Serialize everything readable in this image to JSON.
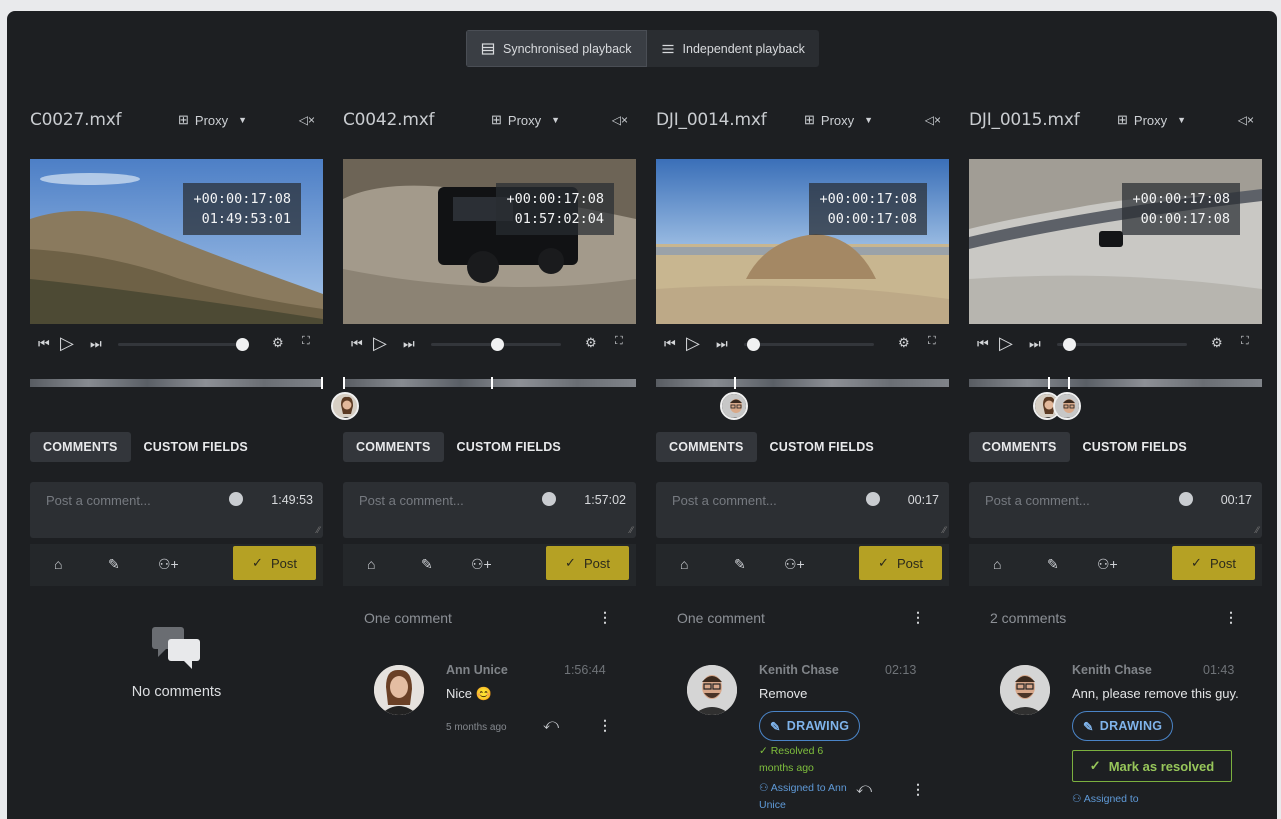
{
  "toolbar": {
    "sync_label": "Synchronised playback",
    "indep_label": "Independent playback"
  },
  "common": {
    "proxy_label": "Proxy",
    "tab_comments": "COMMENTS",
    "tab_custom_fields": "CUSTOM FIELDS",
    "comment_placeholder": "Post a comment...",
    "post_label": "Post"
  },
  "columns": [
    {
      "filename": "C0027.mxf",
      "tc_offset": "+00:00:17:08",
      "tc_abs": "01:49:53:01",
      "compose_time": "1:49:53",
      "progress": 0.93
    },
    {
      "filename": "C0042.mxf",
      "tc_offset": "+00:00:17:08",
      "tc_abs": "01:57:02:04",
      "compose_time": "1:57:02",
      "progress": 0.55
    },
    {
      "filename": "DJI_0014.mxf",
      "tc_offset": "+00:00:17:08",
      "tc_abs": "00:00:17:08",
      "compose_time": "00:17",
      "progress": 0.03
    },
    {
      "filename": "DJI_0015.mxf",
      "tc_offset": "+00:00:17:08",
      "tc_abs": "00:00:17:08",
      "compose_time": "00:17",
      "progress": 0.03
    }
  ],
  "col1": {
    "no_comments": "No comments"
  },
  "col2": {
    "count": "One comment",
    "author": "Ann Unice",
    "time": "1:56:44",
    "text": "Nice 😊",
    "ago": "5 months ago"
  },
  "col3": {
    "count": "One comment",
    "author": "Kenith Chase",
    "time": "02:13",
    "text": "Remove",
    "drawing": "DRAWING",
    "resolved": "✓  Resolved  6 months ago",
    "assigned": "Assigned to Ann Unice"
  },
  "col4": {
    "count": "2 comments",
    "author": "Kenith Chase",
    "time": "01:43",
    "text": "Ann, please remove this guy.",
    "drawing": "DRAWING",
    "mark_resolved": "Mark as resolved",
    "assigned": "Assigned to"
  },
  "colors": {
    "accent": "#b5a124",
    "link": "#4a84c7",
    "success": "#7bb03f"
  }
}
